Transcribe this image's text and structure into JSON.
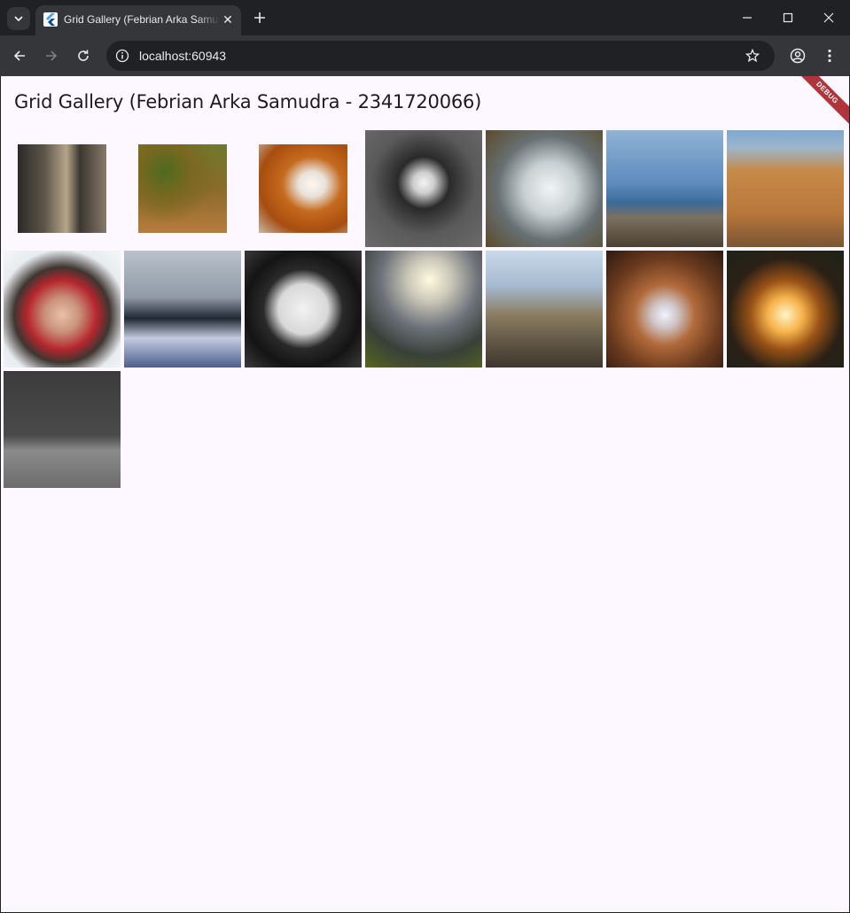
{
  "browser": {
    "tab_title": "Grid Gallery (Febrian Arka Samudra - 2341720066)",
    "url": "localhost:60943"
  },
  "app": {
    "title": "Grid Gallery (Febrian Arka Samudra - 2341720066)",
    "debug_banner": "DEBUG"
  },
  "gallery": {
    "columns": 7,
    "items": [
      {
        "name": "street-photo",
        "style": "i-street",
        "inset": true
      },
      {
        "name": "autumn-path-photo",
        "style": "i-autumn",
        "inset": true
      },
      {
        "name": "orange-tunnel-photo",
        "style": "i-tunnel",
        "inset": true
      },
      {
        "name": "dog-photo",
        "style": "i-dog",
        "inset": false
      },
      {
        "name": "surfer-photo",
        "style": "i-surf",
        "inset": false
      },
      {
        "name": "seagull-photo",
        "style": "i-gull",
        "inset": false
      },
      {
        "name": "canyon-shadows-photo",
        "style": "i-canyon",
        "inset": false
      },
      {
        "name": "winter-girl-photo",
        "style": "i-girl",
        "inset": false
      },
      {
        "name": "snow-tree-photo",
        "style": "i-tree",
        "inset": false
      },
      {
        "name": "clock-photo",
        "style": "i-clock",
        "inset": false
      },
      {
        "name": "sunset-flowers-photo",
        "style": "i-sun",
        "inset": false
      },
      {
        "name": "dome-building-photo",
        "style": "i-dome",
        "inset": false
      },
      {
        "name": "dancer-photo",
        "style": "i-dancer",
        "inset": false
      },
      {
        "name": "fire-photo",
        "style": "i-fire",
        "inset": false
      },
      {
        "name": "rain-drops-photo",
        "style": "i-rain",
        "inset": false
      }
    ]
  },
  "colors": {
    "page_background": "#fdf7ff",
    "chrome_dark": "#202124",
    "chrome_toolbar": "#35363a",
    "debug_banner": "#b0343a"
  }
}
